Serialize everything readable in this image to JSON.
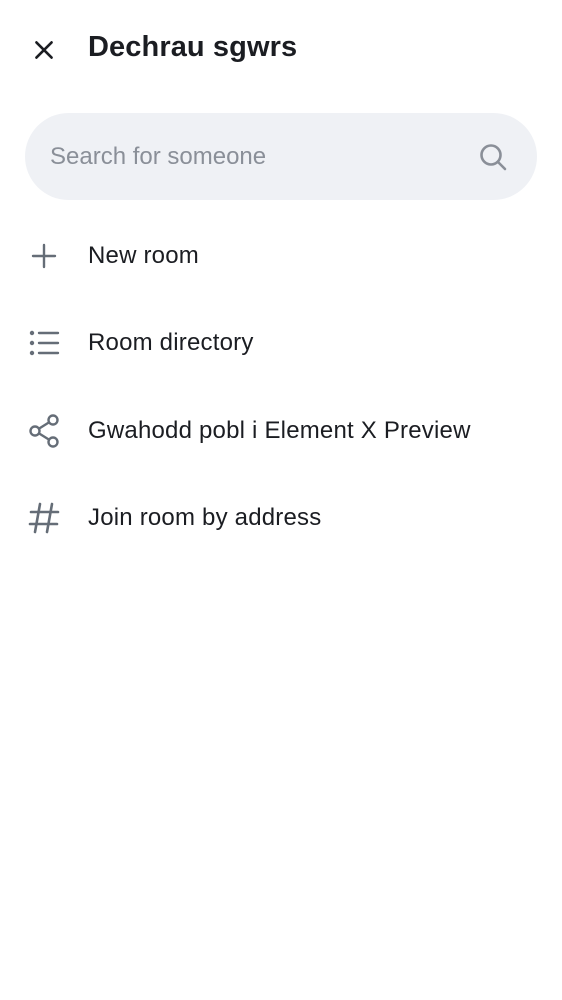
{
  "header": {
    "title": "Dechrau sgwrs",
    "close_icon": "close-icon"
  },
  "search": {
    "placeholder": "Search for someone",
    "value": "",
    "icon": "search-icon"
  },
  "menu": {
    "items": [
      {
        "label": "New room",
        "icon": "plus-icon"
      },
      {
        "label": "Room directory",
        "icon": "list-icon"
      },
      {
        "label": "Gwahodd pobl i Element X Preview",
        "icon": "share-icon"
      },
      {
        "label": "Join room by address",
        "icon": "hash-icon"
      }
    ]
  },
  "colors": {
    "background": "#ffffff",
    "text": "#1b1d22",
    "icon": "#656d77",
    "search_bg": "#eff1f5",
    "placeholder": "#8a8f98"
  }
}
